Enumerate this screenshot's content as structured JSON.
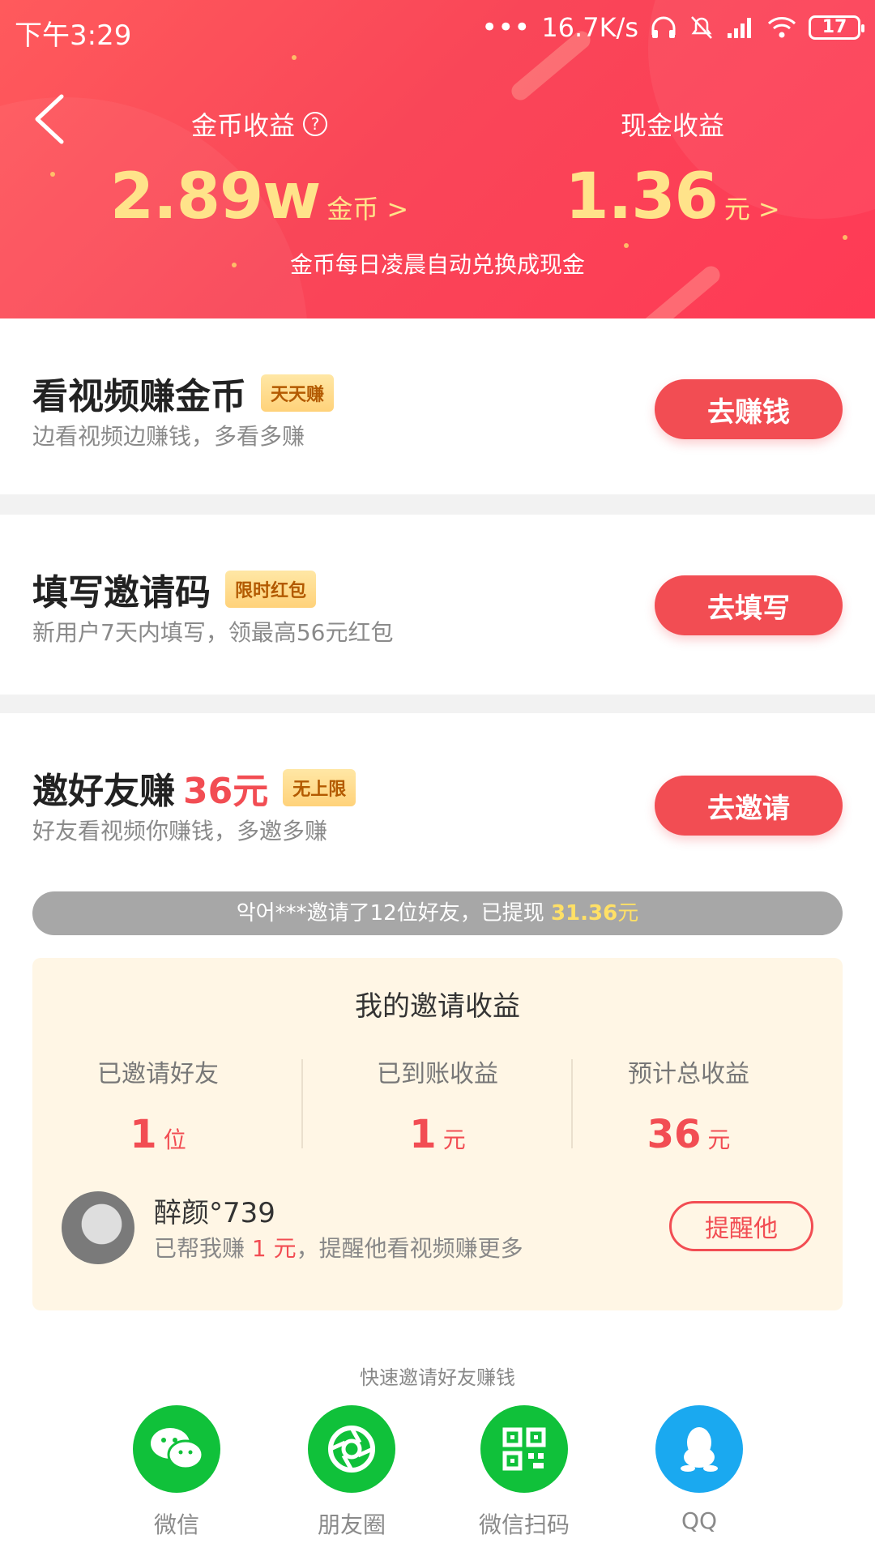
{
  "status_bar": {
    "time": "下午3:29",
    "network_speed": "16.7K/s",
    "battery": "17"
  },
  "header": {
    "coin_label": "金币收益",
    "coin_value": "2.89w",
    "coin_unit": "金币",
    "cash_label": "现金收益",
    "cash_value": "1.36",
    "cash_unit": "元",
    "hint": "金币每日凌晨自动兑换成现金"
  },
  "tasks": [
    {
      "title": "看视频赚金币",
      "tag": "天天赚",
      "subtitle": "边看视频边赚钱，多看多赚",
      "button": "去赚钱"
    },
    {
      "title": "填写邀请码",
      "tag": "限时红包",
      "subtitle": "新用户7天内填写，领最高56元红包",
      "button": "去填写"
    },
    {
      "title": "邀好友赚",
      "amount": "36元",
      "tag": "无上限",
      "subtitle": "好友看视频你赚钱，多邀多赚",
      "button": "去邀请"
    }
  ],
  "ticker": {
    "text": "악어***邀请了12位好友，已提现 ",
    "amount": "31.36",
    "unit": "元"
  },
  "earnings": {
    "title": "我的邀请收益",
    "stats": [
      {
        "label": "已邀请好友",
        "value": "1",
        "unit": "位"
      },
      {
        "label": "已到账收益",
        "value": "1",
        "unit": "元"
      },
      {
        "label": "预计总收益",
        "value": "36",
        "unit": "元"
      }
    ],
    "friend": {
      "name": "醉颜°739",
      "msg_prefix": "已帮我赚 ",
      "msg_amount": "1 元",
      "msg_suffix": "，提醒他看视频赚更多",
      "button": "提醒他"
    }
  },
  "share": {
    "caption": "快速邀请好友赚钱",
    "items": [
      {
        "label": "微信",
        "icon": "wechat-icon",
        "color": "#10c13a"
      },
      {
        "label": "朋友圈",
        "icon": "moments-icon",
        "color": "#10c13a"
      },
      {
        "label": "微信扫码",
        "icon": "qrcode-icon",
        "color": "#10c13a"
      },
      {
        "label": "QQ",
        "icon": "qq-icon",
        "color": "#1aa9f0"
      }
    ]
  },
  "colors": {
    "accent": "#f24d53",
    "gold": "#ffe38a",
    "header_start": "#ff5a5c"
  }
}
